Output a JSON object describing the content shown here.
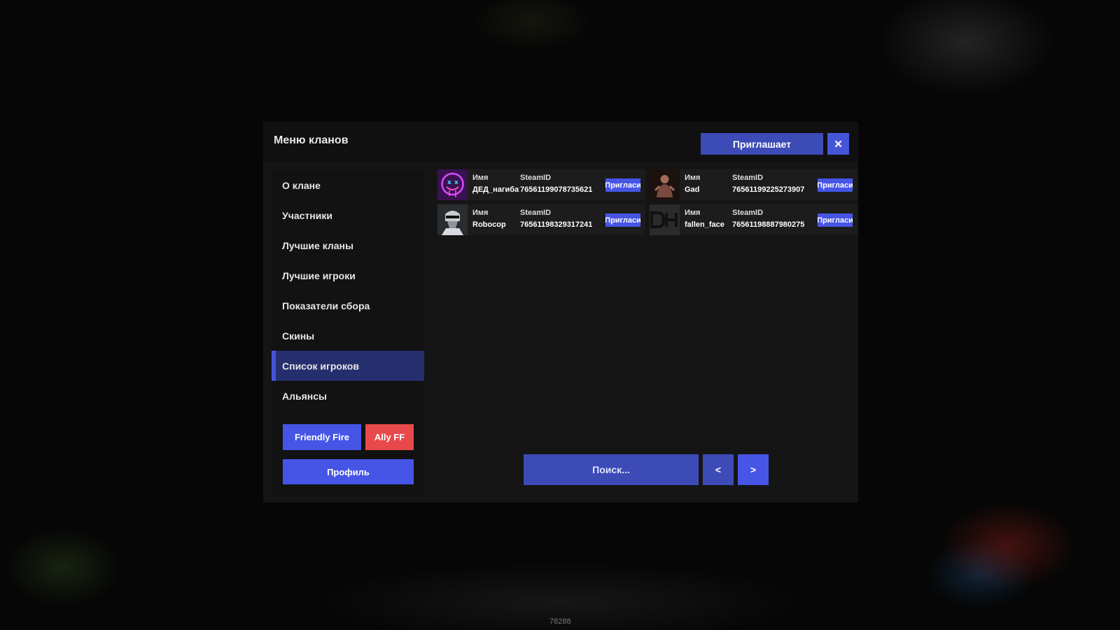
{
  "window": {
    "title": "Меню кланов",
    "invites_label": "Приглашает",
    "close_glyph": "✕"
  },
  "sidebar": {
    "items": [
      {
        "label": "О клане"
      },
      {
        "label": "Участники"
      },
      {
        "label": "Лучшие кланы"
      },
      {
        "label": "Лучшие игроки"
      },
      {
        "label": "Показатели сбора"
      },
      {
        "label": "Скины"
      },
      {
        "label": "Список игроков"
      },
      {
        "label": "Альянсы"
      }
    ],
    "active_index": 6,
    "friendly_fire_label": "Friendly Fire",
    "ally_ff_label": "Ally FF",
    "profile_label": "Профиль"
  },
  "players": {
    "name_header": "Имя",
    "steam_header": "SteamID",
    "invite_label": "Пригласи",
    "list": [
      {
        "name": "ДЕД_нагибатор",
        "steamid": "76561199078735621",
        "avatar": "neon-smiley-avatar-icon"
      },
      {
        "name": "Gad",
        "steamid": "76561199225273907",
        "avatar": "dark-figure-avatar-icon"
      },
      {
        "name": "Robocop",
        "steamid": "76561198329317241",
        "avatar": "robocop-avatar-icon"
      },
      {
        "name": "fallen_face",
        "steamid": "76561198887980275",
        "avatar": "dh-logo-avatar-icon"
      }
    ]
  },
  "pagination": {
    "search_placeholder": "Поиск...",
    "prev_label": "<",
    "next_label": ">"
  },
  "footer": {
    "number": "78288"
  },
  "colors": {
    "accent": "#4655e6",
    "accent_dark": "#3d4bb6",
    "danger": "#e8494a",
    "panel": "#151515"
  }
}
